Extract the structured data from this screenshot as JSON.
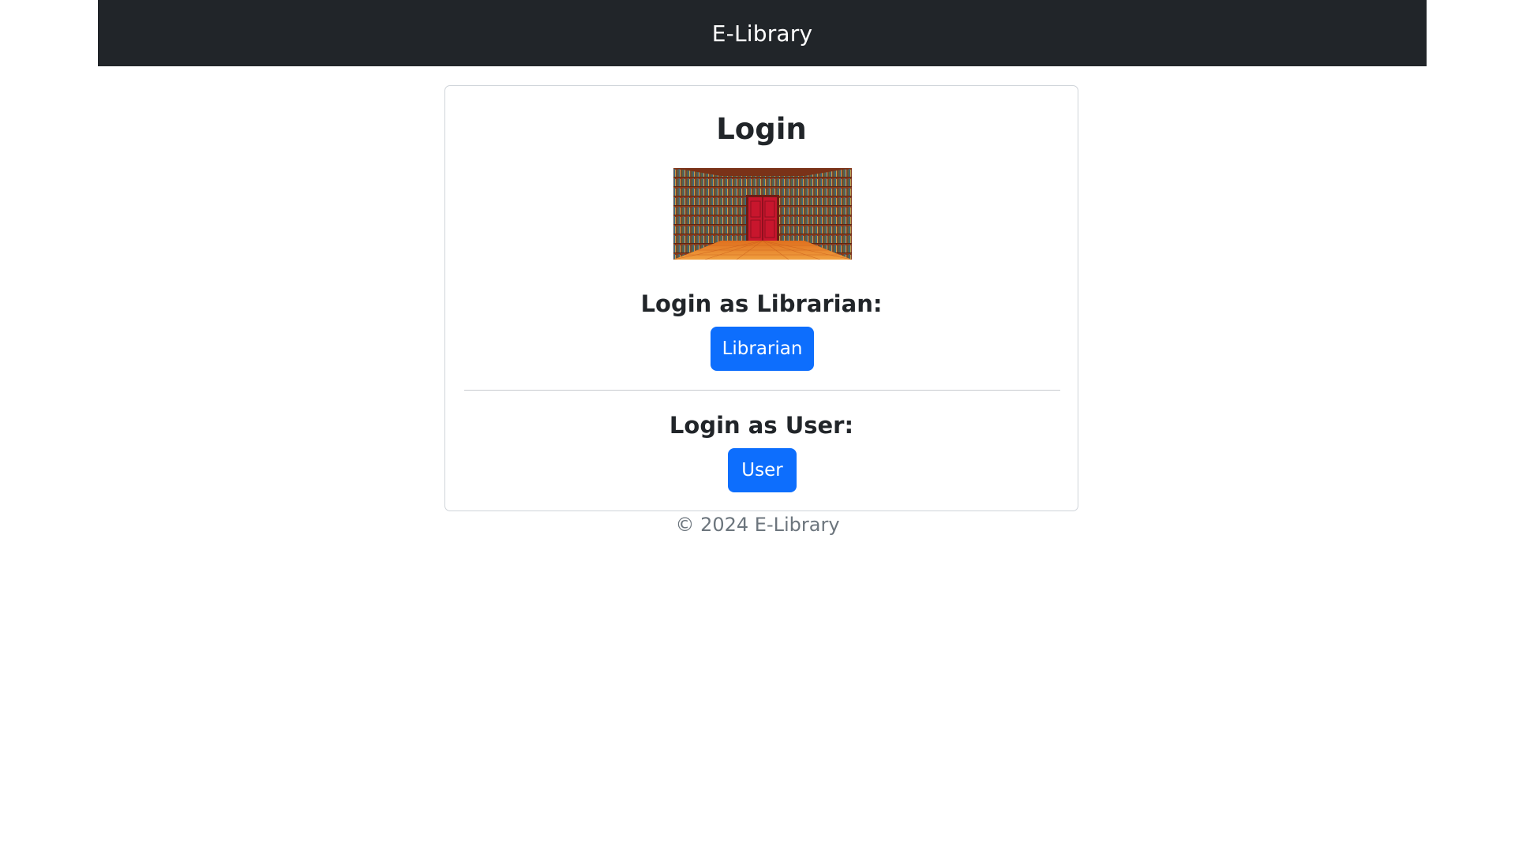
{
  "navbar": {
    "brand": "E-Library"
  },
  "login_card": {
    "title": "Login",
    "image_description_icon": "library-bookshelves-image",
    "librarian": {
      "heading": "Login as Librarian:",
      "button_label": "Librarian"
    },
    "user": {
      "heading": "Login as User:",
      "button_label": "User"
    }
  },
  "footer": {
    "text": "© 2024 E-Library"
  },
  "colors": {
    "navbar_bg": "#212529",
    "primary_button": "#0d6efd",
    "footer_text": "#6c757d"
  }
}
